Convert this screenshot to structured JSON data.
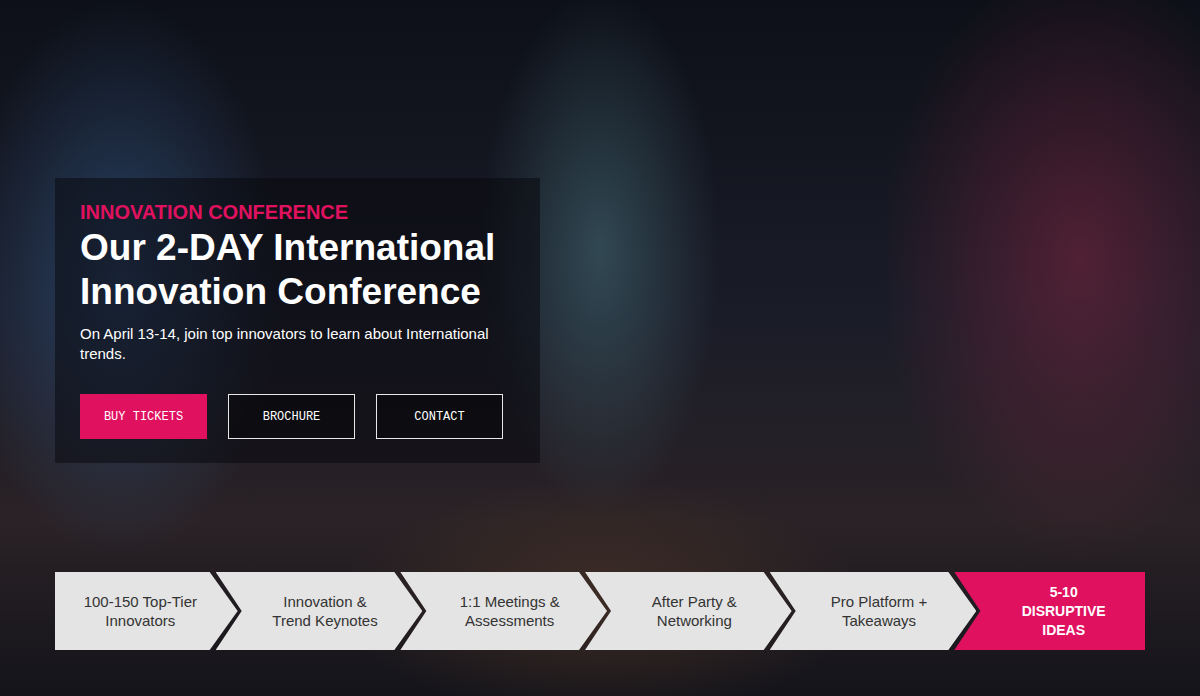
{
  "hero": {
    "eyebrow": "INNOVATION CONFERENCE",
    "title": "Our 2-DAY International Innovation Conference",
    "subtitle": "On April 13-14, join top innovators to learn about International trends.",
    "buttons": [
      {
        "label": "BUY TICKETS",
        "primary": true
      },
      {
        "label": "BROCHURE",
        "primary": false
      },
      {
        "label": "CONTACT",
        "primary": false
      }
    ]
  },
  "features": [
    {
      "label": "100-150 Top-Tier Innovators",
      "highlighted": false
    },
    {
      "label": "Innovation & Trend Keynotes",
      "highlighted": false
    },
    {
      "label": "1:1 Meetings & Assessments",
      "highlighted": false
    },
    {
      "label": "After Party & Networking",
      "highlighted": false
    },
    {
      "label": "Pro Platform + Takeaways",
      "highlighted": false
    },
    {
      "label": "5-10 DISRUPTIVE IDEAS",
      "highlighted": true
    }
  ]
}
